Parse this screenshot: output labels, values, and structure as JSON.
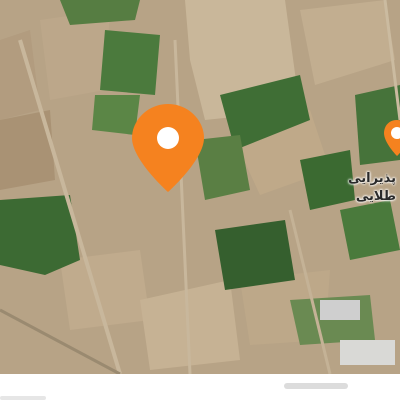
{
  "map": {
    "style": "satellite",
    "colors": {
      "pin": "#f5821f",
      "pin_inner": "#ffffff",
      "soil": "#b9a487",
      "field": "#3f6b34",
      "road": "#c8b79c"
    }
  },
  "poi": {
    "label_line1": "پذیرایی",
    "label_line2": "طلایی",
    "icon": "map-pin-icon"
  },
  "pin": {
    "icon": "location-pin-icon",
    "color": "#f5821f"
  }
}
